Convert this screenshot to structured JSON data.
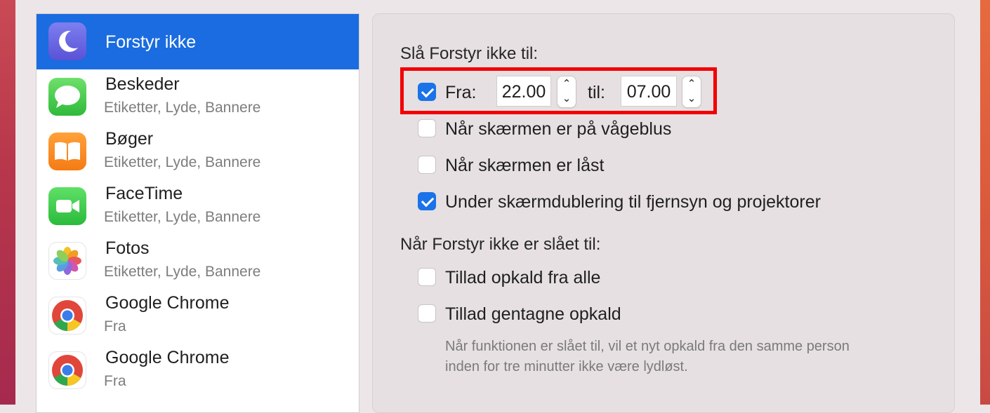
{
  "sidebar": {
    "items": [
      {
        "title": "Forstyr ikke",
        "subtitle": "",
        "icon": "moon-icon",
        "selected": true
      },
      {
        "title": "Beskeder",
        "subtitle": "Etiketter, Lyde, Bannere",
        "icon": "messages-icon"
      },
      {
        "title": "Bøger",
        "subtitle": "Etiketter, Lyde, Bannere",
        "icon": "books-icon"
      },
      {
        "title": "FaceTime",
        "subtitle": "Etiketter, Lyde, Bannere",
        "icon": "facetime-icon"
      },
      {
        "title": "Fotos",
        "subtitle": "Etiketter, Lyde, Bannere",
        "icon": "photos-icon"
      },
      {
        "title": "Google Chrome",
        "subtitle": "Fra",
        "icon": "chrome-icon"
      },
      {
        "title": "Google Chrome",
        "subtitle": "Fra",
        "icon": "chrome-icon"
      }
    ]
  },
  "panel": {
    "turn_on_heading": "Slå Forstyr ikke til:",
    "schedule": {
      "checked": true,
      "from_label": "Fra:",
      "from_value": "22.00",
      "to_label": "til:",
      "to_value": "07.00"
    },
    "options_on": [
      {
        "label": "Når skærmen er på vågeblus",
        "checked": false
      },
      {
        "label": "Når skærmen er låst",
        "checked": false
      },
      {
        "label": "Under skærmdublering til fjernsyn og projektorer",
        "checked": true
      }
    ],
    "when_on_heading": "Når Forstyr ikke er slået til:",
    "options_when": [
      {
        "label": "Tillad opkald fra alle",
        "checked": false
      },
      {
        "label": "Tillad gentagne opkald",
        "checked": false
      }
    ],
    "hint_line1": "Når funktionen er slået til, vil et nyt opkald fra den samme person",
    "hint_line2": "inden for tre minutter ikke være lydløst."
  },
  "colors": {
    "selection": "#1a6ce0",
    "checkbox_checked": "#1a73e8",
    "highlight": "#f20000"
  }
}
